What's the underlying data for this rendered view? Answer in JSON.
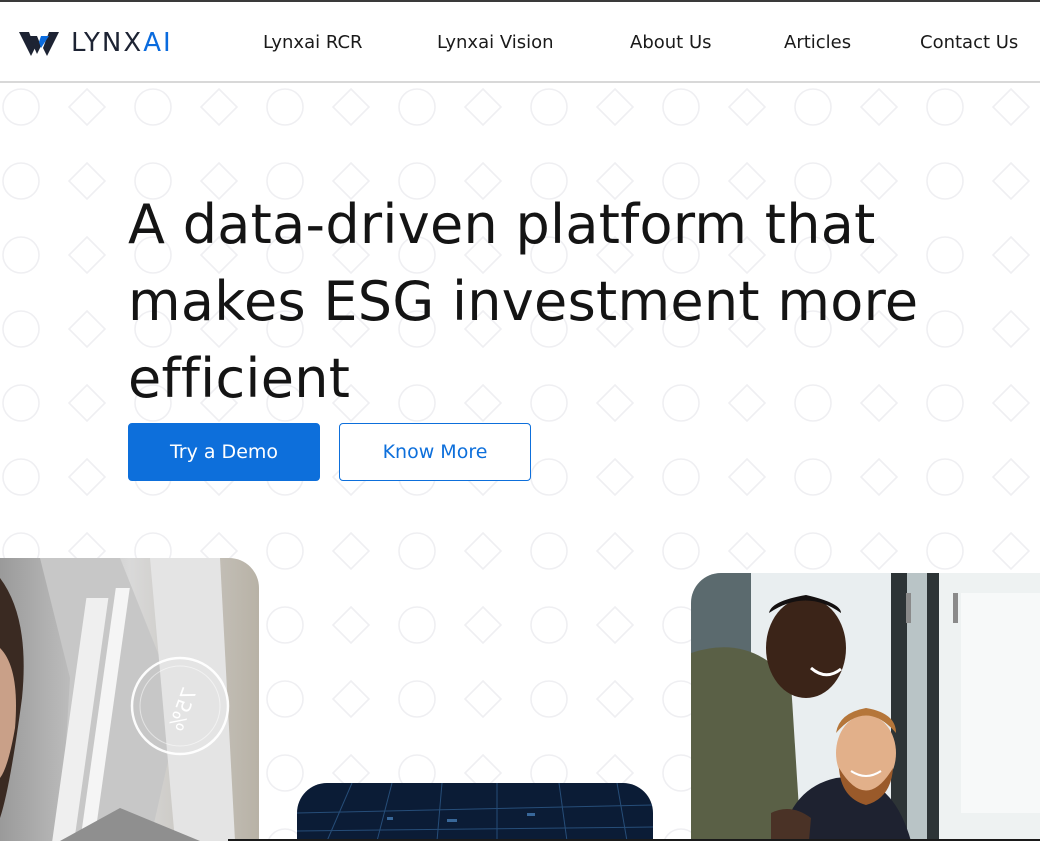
{
  "header": {
    "logo": {
      "icon": "lynxai-logo-icon",
      "text_main": "LYNX",
      "text_accent": "AI",
      "accent_color": "#0a6bde"
    },
    "nav": [
      {
        "label": "Lynxai RCR"
      },
      {
        "label": "Lynxai Vision"
      },
      {
        "label": "About Us"
      },
      {
        "label": "Articles"
      },
      {
        "label": "Contact Us"
      }
    ]
  },
  "hero": {
    "title_line_1": "A data-driven platform that",
    "title_line_2": "makes ESG investment more",
    "title_line_3": "efficient",
    "primary_button": "Try a Demo",
    "secondary_button": "Know More"
  },
  "gallery": {
    "left_card": {
      "overlay_gauge_text": "75%"
    },
    "mid_card": {},
    "right_card": {}
  },
  "colors": {
    "brand_blue": "#0d6fdb",
    "text_dark": "#141414",
    "pattern": "#f1f1f3"
  }
}
